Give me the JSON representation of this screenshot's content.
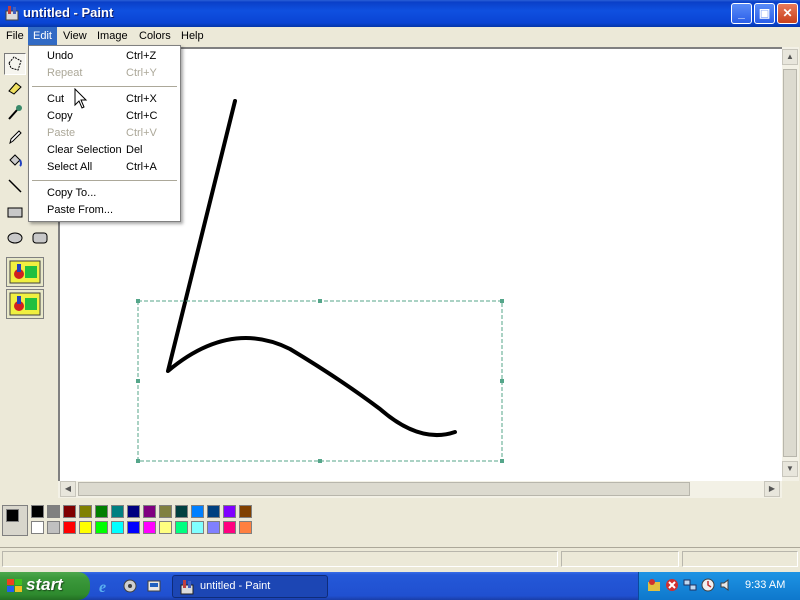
{
  "window": {
    "title": "untitled - Paint",
    "buttons": {
      "minimize": "_",
      "restore": "▣",
      "close": "✕"
    }
  },
  "menubar": [
    {
      "label": "File",
      "active": false
    },
    {
      "label": "Edit",
      "active": true
    },
    {
      "label": "View",
      "active": false
    },
    {
      "label": "Image",
      "active": false
    },
    {
      "label": "Colors",
      "active": false
    },
    {
      "label": "Help",
      "active": false
    }
  ],
  "edit_menu": [
    {
      "label": "Undo",
      "shortcut": "Ctrl+Z",
      "disabled": false
    },
    {
      "label": "Repeat",
      "shortcut": "Ctrl+Y",
      "disabled": true
    },
    {
      "separator": true
    },
    {
      "label": "Cut",
      "shortcut": "Ctrl+X",
      "disabled": false
    },
    {
      "label": "Copy",
      "shortcut": "Ctrl+C",
      "disabled": false
    },
    {
      "label": "Paste",
      "shortcut": "Ctrl+V",
      "disabled": true
    },
    {
      "label": "Clear Selection",
      "shortcut": "Del",
      "disabled": false
    },
    {
      "label": "Select All",
      "shortcut": "Ctrl+A",
      "disabled": false
    },
    {
      "separator": true
    },
    {
      "label": "Copy To...",
      "shortcut": "",
      "disabled": false
    },
    {
      "label": "Paste From...",
      "shortcut": "",
      "disabled": false
    }
  ],
  "tools": [
    {
      "name": "free-form-select-tool",
      "glyph": "⬠",
      "selected": true
    },
    {
      "name": "eraser-tool",
      "glyph": "▱",
      "selected": false
    },
    {
      "name": "color-picker-tool",
      "glyph": "⁄",
      "selected": false
    },
    {
      "name": "pencil-tool",
      "glyph": "✎",
      "selected": false
    },
    {
      "name": "fill-tool",
      "glyph": "◣",
      "selected": false
    },
    {
      "name": "line-tool",
      "glyph": "╲",
      "selected": false
    },
    {
      "name": "rectangle-tool",
      "glyph": "▭",
      "selected": false
    },
    {
      "name": "ellipse-tool",
      "glyph": "⬭",
      "selected": false
    },
    {
      "name": "rounded-rectangle-tool",
      "glyph": "▢",
      "selected": false
    }
  ],
  "palette": {
    "foreground": "#000000",
    "background": "#ffffff",
    "row1": [
      "#000000",
      "#808080",
      "#800000",
      "#808000",
      "#008000",
      "#008080",
      "#000080",
      "#800080",
      "#808040",
      "#004040",
      "#0080ff",
      "#004080",
      "#8000ff",
      "#804000"
    ],
    "row2": [
      "#ffffff",
      "#c0c0c0",
      "#ff0000",
      "#ffff00",
      "#00ff00",
      "#00ffff",
      "#0000ff",
      "#ff00ff",
      "#ffff80",
      "#00ff80",
      "#80ffff",
      "#8080ff",
      "#ff0080",
      "#ff8040"
    ]
  },
  "taskbar": {
    "start_label": "start",
    "task_label": "untitled - Paint",
    "clock": "9:33 AM"
  }
}
